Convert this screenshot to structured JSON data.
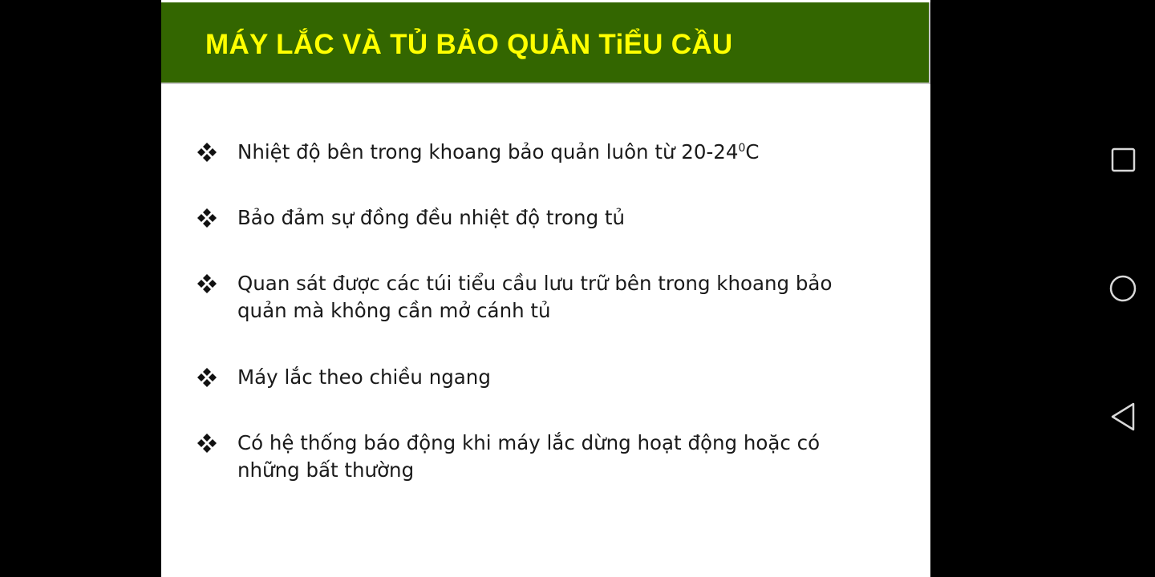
{
  "slide": {
    "title": "MÁY LẮC VÀ TỦ BẢO QUẢN TiỂU CẦU",
    "bullets": [
      {
        "text": "Nhiệt độ bên trong khoang bảo quản luôn từ 20-24",
        "superscript": "0",
        "suffix": "C"
      },
      {
        "text": "Bảo đảm sự đồng đều nhiệt độ trong tủ"
      },
      {
        "text": "Quan sát được các túi tiểu cầu lưu trữ bên trong khoang bảo quản mà không cần mở cánh tủ"
      },
      {
        "text": "Máy lắc theo chiều ngang"
      },
      {
        "text": "Có hệ thống báo động khi máy lắc dừng hoạt động hoặc có những bất thường"
      }
    ],
    "bullet_icon": "four-diamond-bullet-icon",
    "colors": {
      "title_bar": "#336600",
      "title_text": "#ffff00",
      "body_text": "#1a1a1a",
      "background": "#000000"
    }
  },
  "navigation_bar": {
    "buttons": [
      {
        "name": "recents",
        "icon": "square-icon"
      },
      {
        "name": "home",
        "icon": "circle-icon"
      },
      {
        "name": "back",
        "icon": "triangle-back-icon"
      }
    ]
  }
}
